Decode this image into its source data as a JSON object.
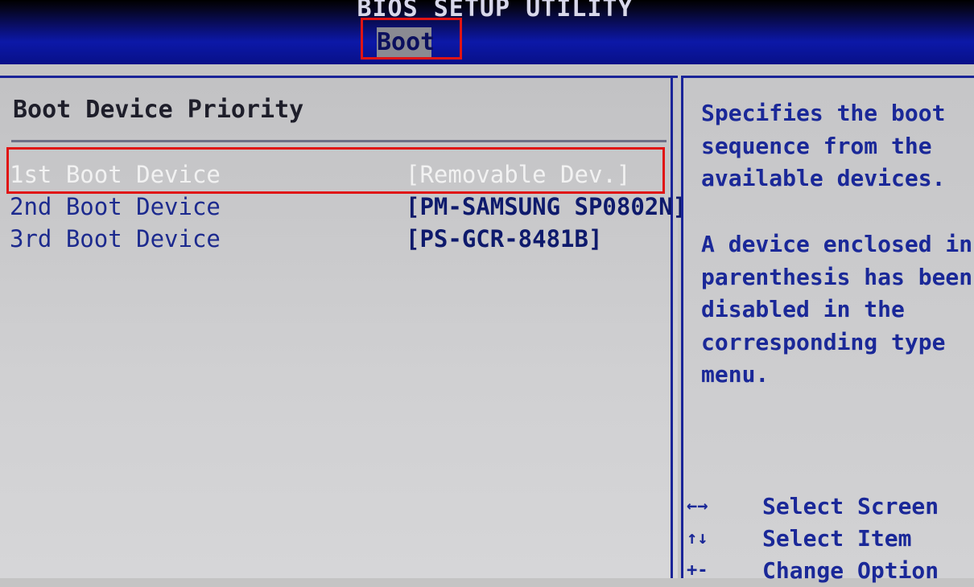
{
  "window": {
    "utility_title": "BIOS SETUP UTILITY",
    "active_tab": "Boot"
  },
  "main": {
    "section_title": "Boot Device Priority",
    "boot_devices": [
      {
        "label": "1st Boot Device",
        "value": "[Removable Dev.]",
        "selected": true
      },
      {
        "label": "2nd Boot Device",
        "value": "[PM-SAMSUNG SP0802N]",
        "selected": false
      },
      {
        "label": "3rd Boot Device",
        "value": "[PS-GCR-8481B]",
        "selected": false
      }
    ]
  },
  "help": {
    "description": "Specifies the boot\nsequence from the\navailable devices.",
    "note": "A device enclosed in\nparenthesis has been\ndisabled in the\ncorresponding type\nmenu.",
    "keys": [
      {
        "symbol": "←→",
        "action": "Select Screen"
      },
      {
        "symbol": "↑↓",
        "action": "Select Item"
      },
      {
        "symbol": "+-",
        "action": "Change Option"
      }
    ]
  },
  "colors": {
    "header_blue": "#0c18a8",
    "panel_gray": "#c4c4c4",
    "text_blue": "#1a2898",
    "highlight_text": "#f2f2f2",
    "annotation_red": "#e01414"
  }
}
